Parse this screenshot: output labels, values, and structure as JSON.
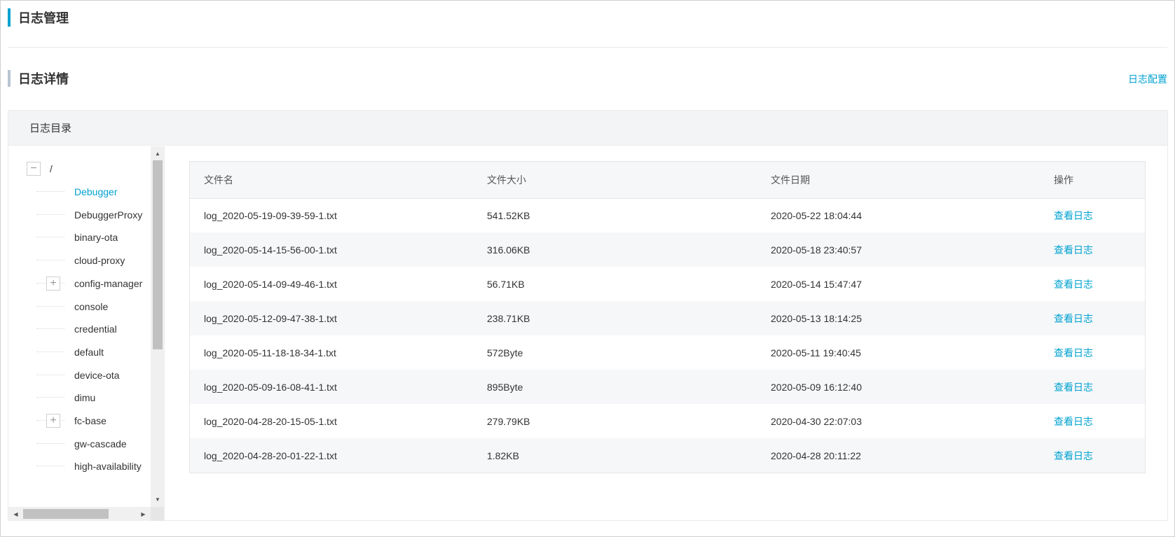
{
  "page": {
    "title": "日志管理"
  },
  "section": {
    "title": "日志详情",
    "config_link": "日志配置"
  },
  "panel": {
    "header": "日志目录"
  },
  "tree": {
    "root": {
      "toggle": "−",
      "label": "/"
    },
    "items": [
      {
        "label": "Debugger",
        "active": true,
        "toggle": ""
      },
      {
        "label": "DebuggerProxy",
        "active": false,
        "toggle": ""
      },
      {
        "label": "binary-ota",
        "active": false,
        "toggle": ""
      },
      {
        "label": "cloud-proxy",
        "active": false,
        "toggle": ""
      },
      {
        "label": "config-manager",
        "active": false,
        "toggle": "+"
      },
      {
        "label": "console",
        "active": false,
        "toggle": ""
      },
      {
        "label": "credential",
        "active": false,
        "toggle": ""
      },
      {
        "label": "default",
        "active": false,
        "toggle": ""
      },
      {
        "label": "device-ota",
        "active": false,
        "toggle": ""
      },
      {
        "label": "dimu",
        "active": false,
        "toggle": ""
      },
      {
        "label": "fc-base",
        "active": false,
        "toggle": "+"
      },
      {
        "label": "gw-cascade",
        "active": false,
        "toggle": ""
      },
      {
        "label": "high-availability",
        "active": false,
        "toggle": ""
      }
    ]
  },
  "table": {
    "headers": [
      "文件名",
      "文件大小",
      "文件日期",
      "操作"
    ],
    "rows": [
      {
        "name": "log_2020-05-19-09-39-59-1.txt",
        "size": "541.52KB",
        "date": "2020-05-22 18:04:44",
        "action": "查看日志"
      },
      {
        "name": "log_2020-05-14-15-56-00-1.txt",
        "size": "316.06KB",
        "date": "2020-05-18 23:40:57",
        "action": "查看日志"
      },
      {
        "name": "log_2020-05-14-09-49-46-1.txt",
        "size": "56.71KB",
        "date": "2020-05-14 15:47:47",
        "action": "查看日志"
      },
      {
        "name": "log_2020-05-12-09-47-38-1.txt",
        "size": "238.71KB",
        "date": "2020-05-13 18:14:25",
        "action": "查看日志"
      },
      {
        "name": "log_2020-05-11-18-18-34-1.txt",
        "size": "572Byte",
        "date": "2020-05-11 19:40:45",
        "action": "查看日志"
      },
      {
        "name": "log_2020-05-09-16-08-41-1.txt",
        "size": "895Byte",
        "date": "2020-05-09 16:12:40",
        "action": "查看日志"
      },
      {
        "name": "log_2020-04-28-20-15-05-1.txt",
        "size": "279.79KB",
        "date": "2020-04-30 22:07:03",
        "action": "查看日志"
      },
      {
        "name": "log_2020-04-28-20-01-22-1.txt",
        "size": "1.82KB",
        "date": "2020-04-28 20:11:22",
        "action": "查看日志"
      }
    ]
  },
  "scrollbars": {
    "up_icon": "▲",
    "down_icon": "▼",
    "left_icon": "◀",
    "right_icon": "▶"
  },
  "colors": {
    "accent": "#00a2d0",
    "section_bar": "#b9c4d2",
    "header_bg": "#f3f4f6"
  }
}
